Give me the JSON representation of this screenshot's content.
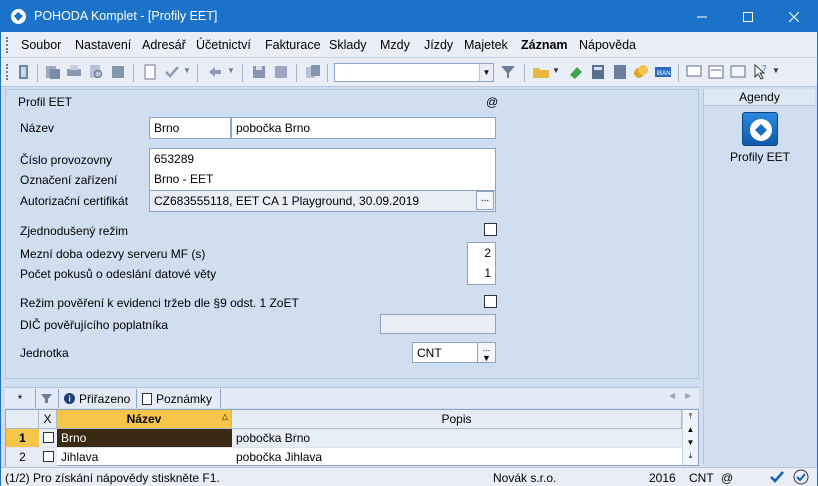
{
  "window": {
    "title": "POHODA Komplet - [Profily EET]"
  },
  "menu": [
    "Soubor",
    "Nastavení",
    "Adresář",
    "Účetnictví",
    "Fakturace",
    "Sklady",
    "Mzdy",
    "Jízdy",
    "Majetek",
    "Záznam",
    "Nápověda"
  ],
  "toolbar": {
    "search_value": ""
  },
  "form": {
    "section_title": "Profil EET",
    "at_symbol": "@",
    "nazev_label": "Název",
    "nazev_code": "Brno",
    "nazev_text": "pobočka Brno",
    "provozovna_label": "Číslo provozovny",
    "provozovna_value": "653289",
    "zarizeni_label": "Označení zařízení",
    "zarizeni_value": "Brno - EET",
    "certifikat_label": "Autorizační certifikát",
    "certifikat_value": "CZ683555118, EET CA 1 Playground, 30.09.2019",
    "certifikat_button": "...",
    "zjednoduseny_label": "Zjednodušený režim",
    "mezni_doba_label": "Mezní doba odezvy serveru MF (s)",
    "mezni_doba_value": "2",
    "pocet_pokusu_label": "Počet pokusů o odeslání datové věty",
    "pocet_pokusu_value": "1",
    "poverení_label": "Režim pověření k evidenci tržeb dle §9 odst. 1 ZoET",
    "dic_label": "DIČ pověřujícího poplatníka",
    "dic_value": "",
    "jednotka_label": "Jednotka",
    "jednotka_value": "CNT"
  },
  "agendy": {
    "header": "Agendy",
    "item_label": "Profily EET"
  },
  "tabs": {
    "star": "*",
    "prirazeno": "Přiřazeno",
    "poznamky": "Poznámky"
  },
  "grid": {
    "columns": {
      "x": "X",
      "nazev": "Název",
      "popis": "Popis"
    },
    "rows": [
      {
        "num": "1",
        "nazev": "Brno",
        "popis": "pobočka Brno"
      },
      {
        "num": "2",
        "nazev": "Jihlava",
        "popis": "pobočka Jihlava"
      }
    ]
  },
  "status": {
    "help": "(1/2) Pro získání nápovědy stiskněte F1.",
    "company": "Novák s.r.o.",
    "year": "2016",
    "unit": "CNT",
    "at": "@"
  }
}
